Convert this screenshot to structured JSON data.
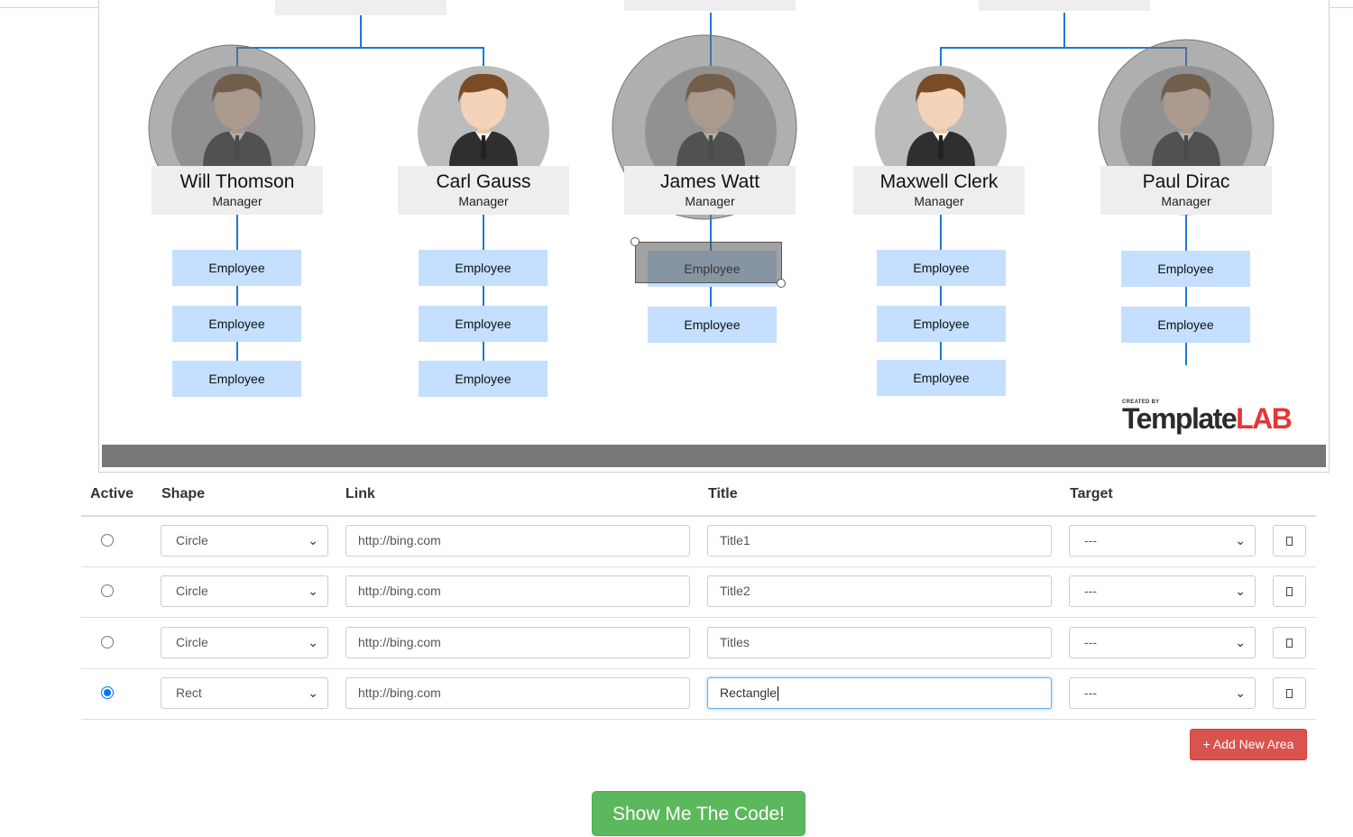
{
  "org_chart": {
    "managers": [
      {
        "name": "Will Thomson",
        "role": "Manager"
      },
      {
        "name": "Carl Gauss",
        "role": "Manager"
      },
      {
        "name": "James Watt",
        "role": "Manager"
      },
      {
        "name": "Maxwell Clerk",
        "role": "Manager"
      },
      {
        "name": "Paul Dirac",
        "role": "Manager"
      }
    ],
    "employee_label": "Employee",
    "logo": {
      "created_by": "CREATED BY",
      "text_main": "Template",
      "text_accent": "LAB"
    }
  },
  "table": {
    "headers": {
      "active": "Active",
      "shape": "Shape",
      "link": "Link",
      "title": "Title",
      "target": "Target"
    },
    "rows": [
      {
        "active": false,
        "shape": "Circle",
        "link": "http://bing.com",
        "title": "Title1",
        "target": "---"
      },
      {
        "active": false,
        "shape": "Circle",
        "link": "http://bing.com",
        "title": "Title2",
        "target": "---"
      },
      {
        "active": false,
        "shape": "Circle",
        "link": "http://bing.com",
        "title": "Titles",
        "target": "---"
      },
      {
        "active": true,
        "shape": "Rect",
        "link": "http://bing.com",
        "title": "Rectangle",
        "target": "---"
      }
    ]
  },
  "buttons": {
    "add_new_area": "+ Add New Area",
    "show_code": "Show Me The Code!"
  },
  "colors": {
    "connector": "#1a7ad4",
    "employee_box": "#c4dfff",
    "add_button": "#d9534f",
    "show_button": "#5cb85c",
    "radio_checked": "#0075ff"
  }
}
